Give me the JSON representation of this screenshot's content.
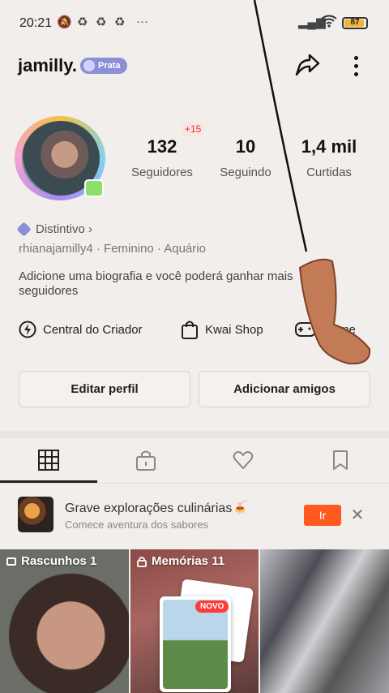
{
  "status_bar": {
    "time": "20:21",
    "icons": [
      "mute-icon",
      "recycle-icon",
      "recycle-icon",
      "recycle-icon",
      "more-dots-icon"
    ],
    "battery_level": "87"
  },
  "profile": {
    "username": "jamilly.",
    "badge_label": "Prata",
    "stats": [
      {
        "value": "132",
        "label": "Seguidores"
      },
      {
        "value": "10",
        "label": "Seguindo"
      },
      {
        "value": "1,4 mil",
        "label": "Curtidas"
      }
    ],
    "followers_increment": "+15",
    "distintivo_label": "Distintivo",
    "meta": "rhianajamilly4 · Feminino · Aquário",
    "bio": "Adicione uma biografia e você poderá ganhar mais seguidores"
  },
  "shortcuts": [
    {
      "label": "Central do Criador",
      "icon": "lightning-icon"
    },
    {
      "label": "Kwai Shop",
      "icon": "bag-icon"
    },
    {
      "label": "Game",
      "icon": "gamepad-icon"
    }
  ],
  "buttons": {
    "edit_profile": "Editar perfil",
    "add_friends": "Adicionar amigos"
  },
  "tabs": [
    {
      "icon": "grid-icon",
      "active": true
    },
    {
      "icon": "lock-icon",
      "active": false
    },
    {
      "icon": "heart-icon",
      "active": false
    },
    {
      "icon": "bookmark-icon",
      "active": false
    }
  ],
  "promo": {
    "title": "Grave explorações culinárias🍝",
    "subtitle": "Comece aventura dos sabores",
    "button": "Ir",
    "close": "✕"
  },
  "grid": {
    "drafts_label": "Rascunhos 1",
    "memories_label": "Memórias 11",
    "new_badge": "NOVO"
  },
  "colors": {
    "accent": "#ff5a1f",
    "badge": "#8a8fd8",
    "increment": "#e0322d"
  }
}
